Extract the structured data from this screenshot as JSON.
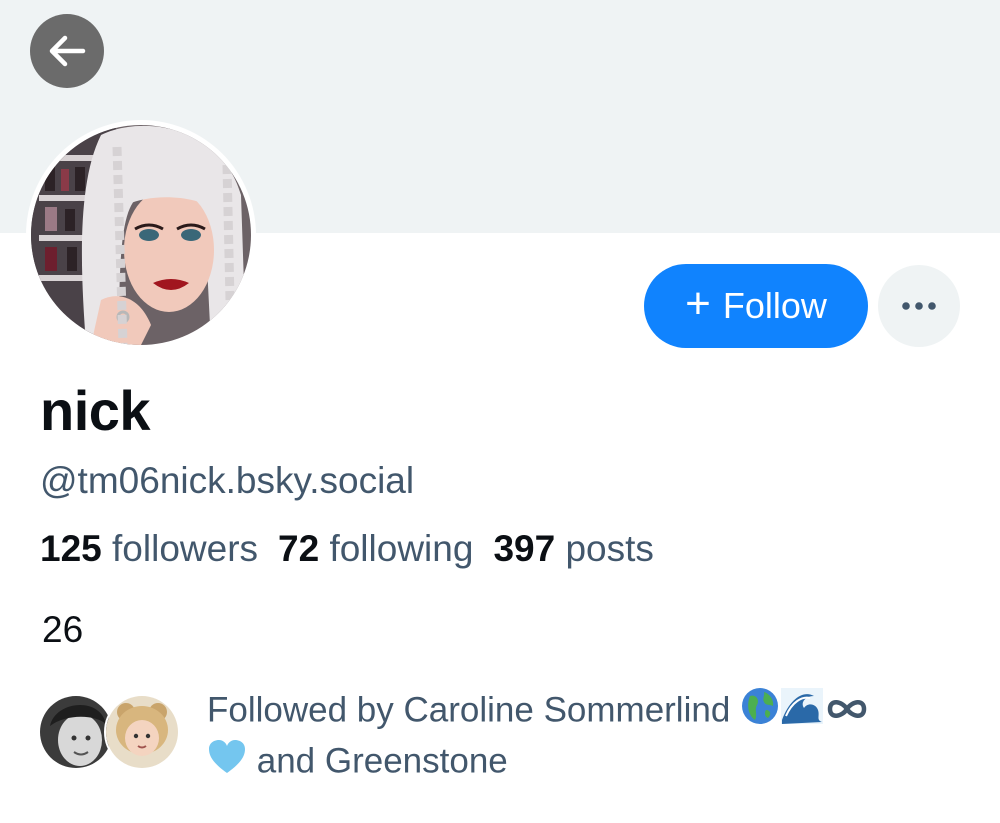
{
  "profile": {
    "display_name": "nick",
    "handle": "@tm06nick.bsky.social",
    "bio": "26"
  },
  "stats": {
    "followers_count": "125",
    "followers_label": "followers",
    "following_count": "72",
    "following_label": "following",
    "posts_count": "397",
    "posts_label": "posts"
  },
  "actions": {
    "follow_label": "Follow",
    "back_icon": "arrow-left-icon",
    "more_icon": "ellipsis-icon"
  },
  "followed_by": {
    "prefix": "Followed by",
    "first_name": "Caroline Sommerlind",
    "connector": "and",
    "second_name": "Greenstone"
  },
  "colors": {
    "accent": "#1083fe",
    "banner": "#eff3f4",
    "muted_text": "#42576c",
    "primary_text": "#0b0f14"
  }
}
